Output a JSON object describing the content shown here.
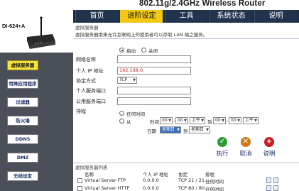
{
  "product": "802.11g/2.4GHz Wireless Router",
  "device_model": "DI-624+A",
  "nav": {
    "tabs": [
      {
        "label": "首页",
        "active": false
      },
      {
        "label": "进阶设定",
        "active": true
      },
      {
        "label": "工具",
        "active": false
      },
      {
        "label": "系统状态",
        "active": false
      },
      {
        "label": "说明",
        "active": false
      }
    ]
  },
  "sidebar": {
    "items": [
      {
        "label": "虚拟服务器",
        "active": true
      },
      {
        "label": "特殊应用程序",
        "active": false
      },
      {
        "label": "过滤器",
        "active": false
      },
      {
        "label": "防火墙",
        "active": false
      },
      {
        "label": "DDNS",
        "active": false
      },
      {
        "label": "DMZ",
        "active": false
      },
      {
        "label": "无线设定",
        "active": false
      }
    ]
  },
  "virtual_server": {
    "section_title": "虚拟服务器",
    "description": "虚拟服务器用来允许互联网上的使用者可以存取 LAN 端之服务。",
    "enable_label": "启动",
    "disable_label": "关闭",
    "enabled": true,
    "name_label": "网络名称",
    "name_value": "",
    "ip_label": "个人 IP 地址",
    "ip_value": "192.168.0.",
    "protocol_label": "协定方式",
    "protocol_value": "TCP",
    "private_port_label": "个人服务端口",
    "private_port_value": "",
    "public_port_label": "公用服务端口",
    "public_port_value": "",
    "schedule_label": "排程",
    "schedule_any_label": "任何时间",
    "schedule_from_label": "从",
    "schedule_time_label": "时间",
    "schedule_from_hour": "00",
    "schedule_from_min": "00",
    "schedule_am": "上午",
    "schedule_to_label": "到",
    "schedule_to_hour": "00",
    "schedule_to_min": "00",
    "schedule_pm": "上午",
    "day_label": "日期",
    "day_from": "星期日",
    "day_to_label": "到",
    "day_to": "星期日"
  },
  "actions": {
    "apply_label": "执行",
    "cancel_label": "取消",
    "help_label": "说明",
    "colors": {
      "apply": "#2f9a2f",
      "cancel": "#d07a14",
      "help": "#c41e1e"
    }
  },
  "list": {
    "title": "虚拟服务器列表",
    "columns": [
      "名称",
      "个人 IP 地址",
      "协定",
      "排程"
    ],
    "rows": [
      {
        "name": "Virtual Server FTP",
        "ip": "0.0.0.0",
        "protocol": "TCP 21 / 21",
        "schedule": "任何时间"
      },
      {
        "name": "Virtual Server HTTP",
        "ip": "0.0.0.0",
        "protocol": "TCP 80 / 80",
        "schedule": "任何时间"
      }
    ]
  }
}
